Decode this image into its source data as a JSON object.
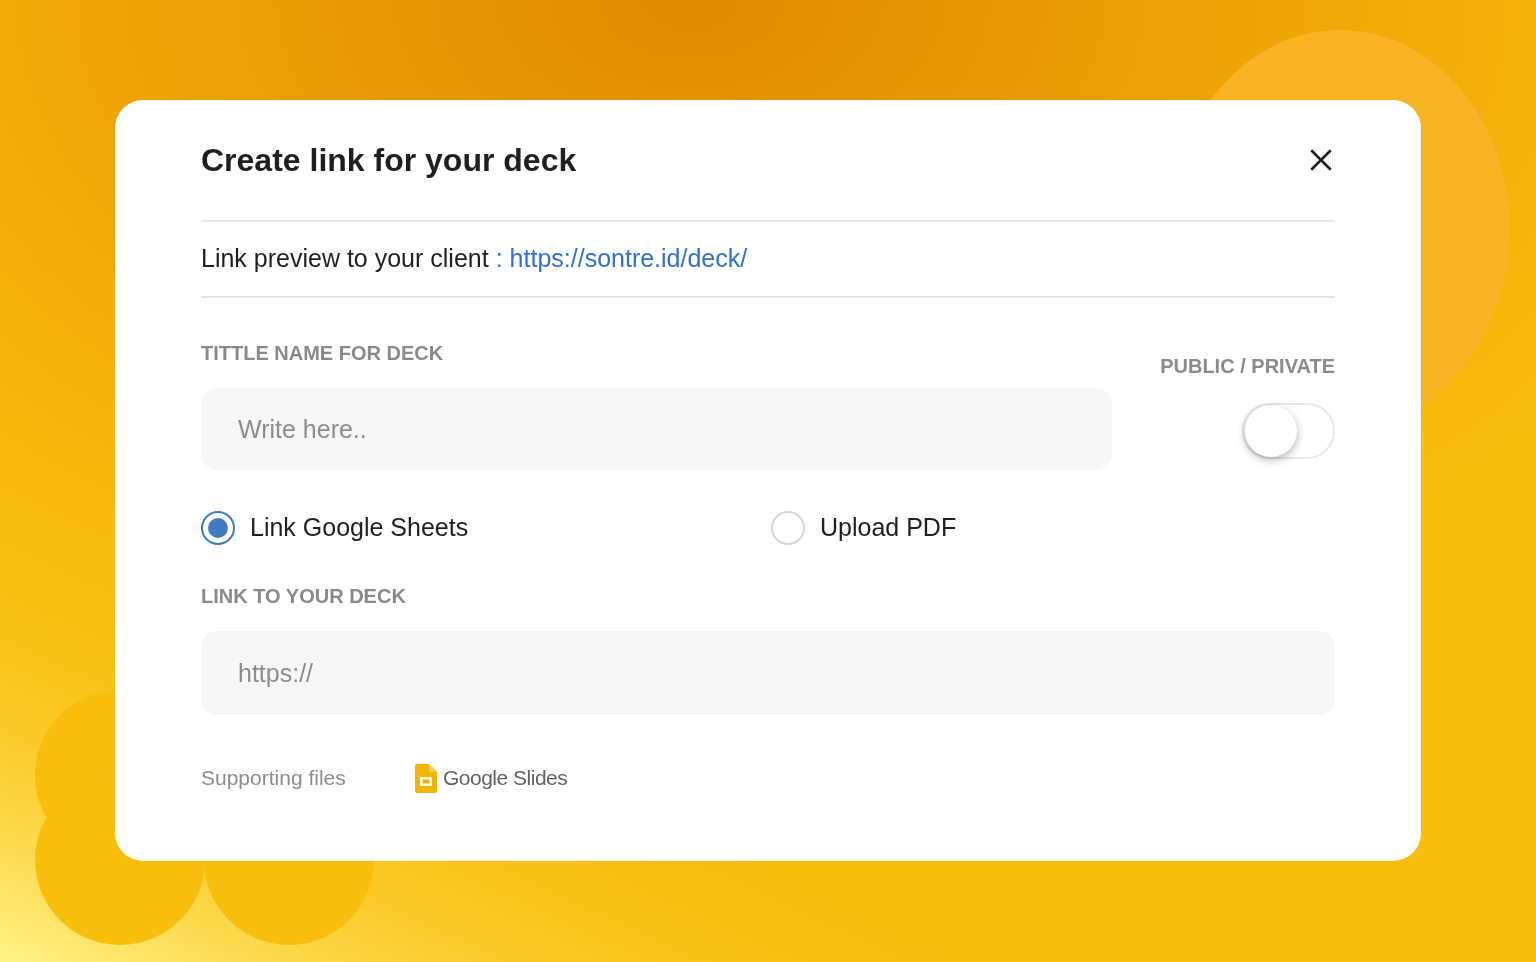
{
  "dialog": {
    "title": "Create link for your deck",
    "preview": {
      "label": "Link preview to your client",
      "separator": ":",
      "url": "https://sontre.id/deck/"
    },
    "title_field": {
      "label": "TITTLE NAME FOR DECK",
      "placeholder": "Write here.."
    },
    "visibility": {
      "label": "PUBLIC / PRIVATE",
      "on": false
    },
    "sources": [
      {
        "label": "Link Google Sheets",
        "selected": true
      },
      {
        "label": "Upload PDF",
        "selected": false
      }
    ],
    "link_field": {
      "label": "LINK TO YOUR DECK",
      "placeholder": "https://"
    },
    "supporting": {
      "label": "Supporting files",
      "files": [
        {
          "name": "Google Slides"
        }
      ]
    }
  }
}
